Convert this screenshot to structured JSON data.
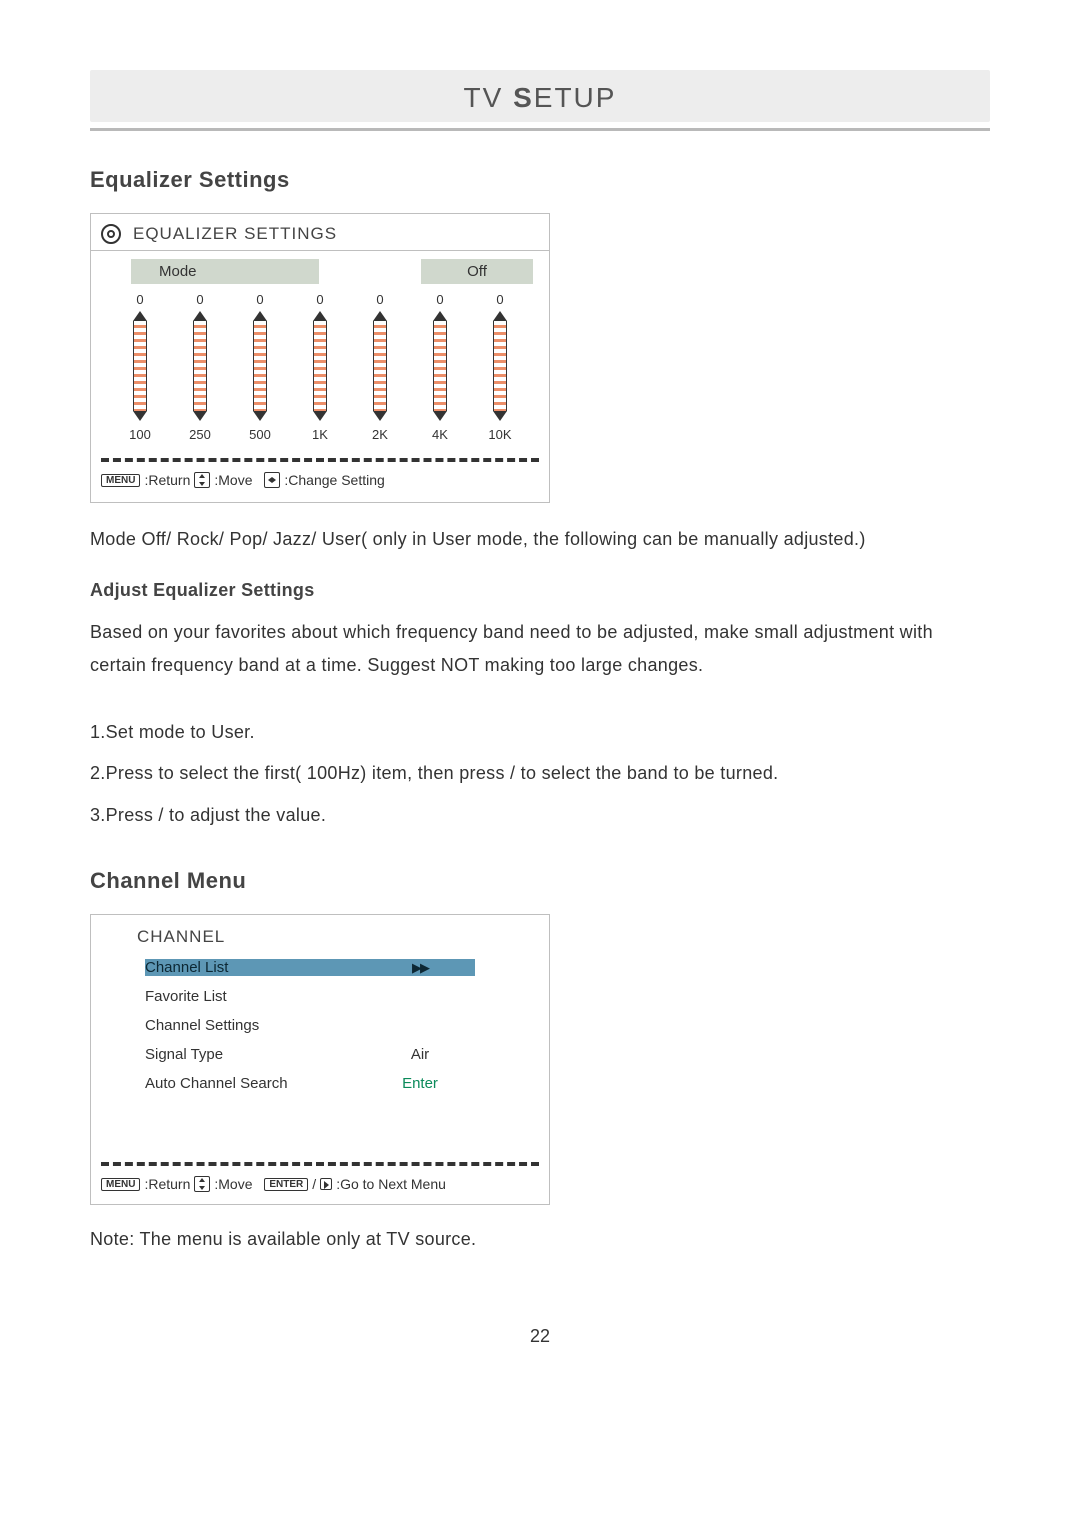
{
  "title": {
    "pre": "TV ",
    "bold": "S",
    "post": "ETUP"
  },
  "page_number": "22",
  "equalizer": {
    "section_heading": "Equalizer Settings",
    "panel_title": "EQUALIZER SETTINGS",
    "mode_label": "Mode",
    "mode_value": "Off",
    "bands": [
      {
        "value": "0",
        "freq": "100"
      },
      {
        "value": "0",
        "freq": "250"
      },
      {
        "value": "0",
        "freq": "500"
      },
      {
        "value": "0",
        "freq": "1K"
      },
      {
        "value": "0",
        "freq": "2K"
      },
      {
        "value": "0",
        "freq": "4K"
      },
      {
        "value": "0",
        "freq": "10K"
      }
    ],
    "hints": {
      "menu_key": "MENU",
      "return_label": ":Return",
      "move_label": ":Move",
      "change_label": ":Change Setting"
    },
    "mode_desc": "Mode Off/ Rock/ Pop/ Jazz/ User( only in User mode, the following can be manually adjusted.)",
    "adjust_heading": "Adjust Equalizer Settings",
    "adjust_desc": "Based on your favorites about which frequency band need to be adjusted, make small adjustment with certain frequency band at a time. Suggest NOT making too large changes.",
    "step1": "1.Set mode to User.",
    "step2": "2.Press      to select the first( 100Hz) item, then press      /      to select the band to be turned.",
    "step3": "3.Press      /      to adjust the value."
  },
  "channel": {
    "section_heading": "Channel Menu",
    "panel_title": "CHANNEL",
    "items": [
      {
        "label": "Channel List",
        "value": "▸▸",
        "selected": true
      },
      {
        "label": "Favorite List",
        "value": ""
      },
      {
        "label": "Channel Settings",
        "value": ""
      },
      {
        "label": "Signal Type",
        "value": "Air"
      },
      {
        "label": "Auto Channel Search",
        "value": "Enter",
        "enter": true
      }
    ],
    "hints": {
      "menu_key": "MENU",
      "return_label": ":Return",
      "move_label": ":Move",
      "enter_key": "ENTER",
      "goto_label": ":Go to Next Menu"
    },
    "note": "Note: The menu is available only at TV source."
  }
}
